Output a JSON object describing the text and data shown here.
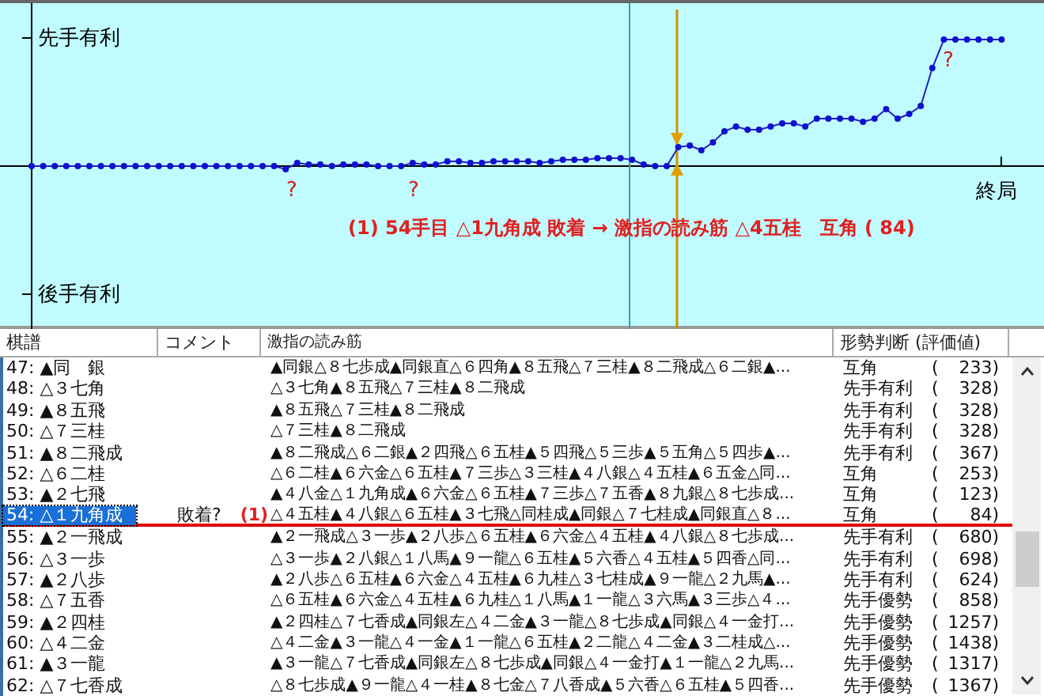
{
  "graph": {
    "upper_label": "先手有利",
    "lower_label": "後手有利",
    "end_label": "終局",
    "question_marks": [
      "?",
      "?",
      "?"
    ],
    "annotation": "(1) 54手目 △1九角成 敗着 → 激指の読み筋 △4五桂　互角 ( 84)"
  },
  "table": {
    "columns": [
      "棋譜",
      "コメント",
      "激指の読み筋",
      "形勢判断 (評価値)"
    ],
    "rows": [
      {
        "move": "47: ▲同　銀",
        "line": "▲同銀△８七歩成▲同銀直△６四角▲８五飛△７三桂▲８二飛成△６二銀▲...",
        "judgement": "互角",
        "paren_open": "(",
        "value": "233",
        "paren_close": ")",
        "selected": false
      },
      {
        "move": "48: △３七角",
        "line": "△３七角▲８五飛△７三桂▲８二飛成",
        "judgement": "先手有利",
        "paren_open": "(",
        "value": "328",
        "paren_close": ")",
        "selected": false
      },
      {
        "move": "49: ▲８五飛",
        "line": "▲８五飛△７三桂▲８二飛成",
        "judgement": "先手有利",
        "paren_open": "(",
        "value": "328",
        "paren_close": ")",
        "selected": false
      },
      {
        "move": "50: △７三桂",
        "line": "△７三桂▲８二飛成",
        "judgement": "先手有利",
        "paren_open": "(",
        "value": "328",
        "paren_close": ")",
        "selected": false
      },
      {
        "move": "51: ▲８二飛成",
        "line": "▲８二飛成△６二銀▲２四飛△６五桂▲５四飛△５三歩▲５五角△５四歩▲...",
        "judgement": "先手有利",
        "paren_open": "(",
        "value": "367",
        "paren_close": ")",
        "selected": false
      },
      {
        "move": "52: △６二桂",
        "line": "△６二桂▲６六金△６五桂▲７三歩△３三桂▲４八銀△４五桂▲６五金△同...",
        "judgement": "互角",
        "paren_open": "(",
        "value": "253",
        "paren_close": ")",
        "selected": false
      },
      {
        "move": "53: ▲２七飛",
        "line": "▲４八金△１九角成▲６六金△６五桂▲７三歩△７五香▲８九銀△８七歩成...",
        "judgement": "互角",
        "paren_open": "(",
        "value": "123",
        "paren_close": ")",
        "selected": false
      },
      {
        "move": "54: △１九角成",
        "comment": "敗着?",
        "comment_mark": "(1)",
        "line": "△４五桂▲４八銀△６五桂▲３七飛△同桂成▲同銀△７七桂成▲同銀直△８...",
        "judgement": "互角",
        "paren_open": "(",
        "value": "84",
        "paren_close": ")",
        "selected": true
      },
      {
        "move": "55: ▲２一飛成",
        "line": "▲２一飛成△３一歩▲２八歩△６五桂▲６六金△４五桂▲４八銀△８七歩成...",
        "judgement": "先手有利",
        "paren_open": "(",
        "value": "680",
        "paren_close": ")",
        "selected": false
      },
      {
        "move": "56: △３一歩",
        "line": "△３一歩▲２八銀△１八馬▲９一龍△６五桂▲５六香△４五桂▲５四香△同...",
        "judgement": "先手有利",
        "paren_open": "(",
        "value": "698",
        "paren_close": ")",
        "selected": false
      },
      {
        "move": "57: ▲２八歩",
        "line": "▲２八歩△６五桂▲６六金△４五桂▲６九桂△３七桂成▲９一龍△２九馬▲...",
        "judgement": "先手有利",
        "paren_open": "(",
        "value": "624",
        "paren_close": ")",
        "selected": false
      },
      {
        "move": "58: △７五香",
        "line": "△６五桂▲６六金△４五桂▲６九桂△１八馬▲１一龍△３六馬▲３三歩△４...",
        "judgement": "先手優勢",
        "paren_open": "(",
        "value": "858",
        "paren_close": ")",
        "selected": false
      },
      {
        "move": "59: ▲２四桂",
        "line": "▲２四桂△７七香成▲同銀左△４二金▲３一龍△８七歩成▲同銀△４一金打...",
        "judgement": "先手優勢",
        "paren_open": "(",
        "value": "1257",
        "paren_close": ")",
        "selected": false
      },
      {
        "move": "60: △４二金",
        "line": "△４二金▲３一龍△４一金▲１一龍△６五桂▲２二龍△４二金▲３二桂成△...",
        "judgement": "先手優勢",
        "paren_open": "(",
        "value": "1438",
        "paren_close": ")",
        "selected": false
      },
      {
        "move": "61: ▲３一龍",
        "line": "▲３一龍△７七香成▲同銀左△８七歩成▲同銀△４一金打▲１一龍△２九馬...",
        "judgement": "先手優勢",
        "paren_open": "(",
        "value": "1317",
        "paren_close": ")",
        "selected": false
      },
      {
        "move": "62: △７七香成",
        "line": "△８七歩成▲９一龍△４一桂▲８七金△７八香成▲５六香△６五桂▲５四香...",
        "judgement": "先手優勢",
        "paren_open": "(",
        "value": "1367",
        "paren_close": ")",
        "selected": false
      }
    ]
  }
}
